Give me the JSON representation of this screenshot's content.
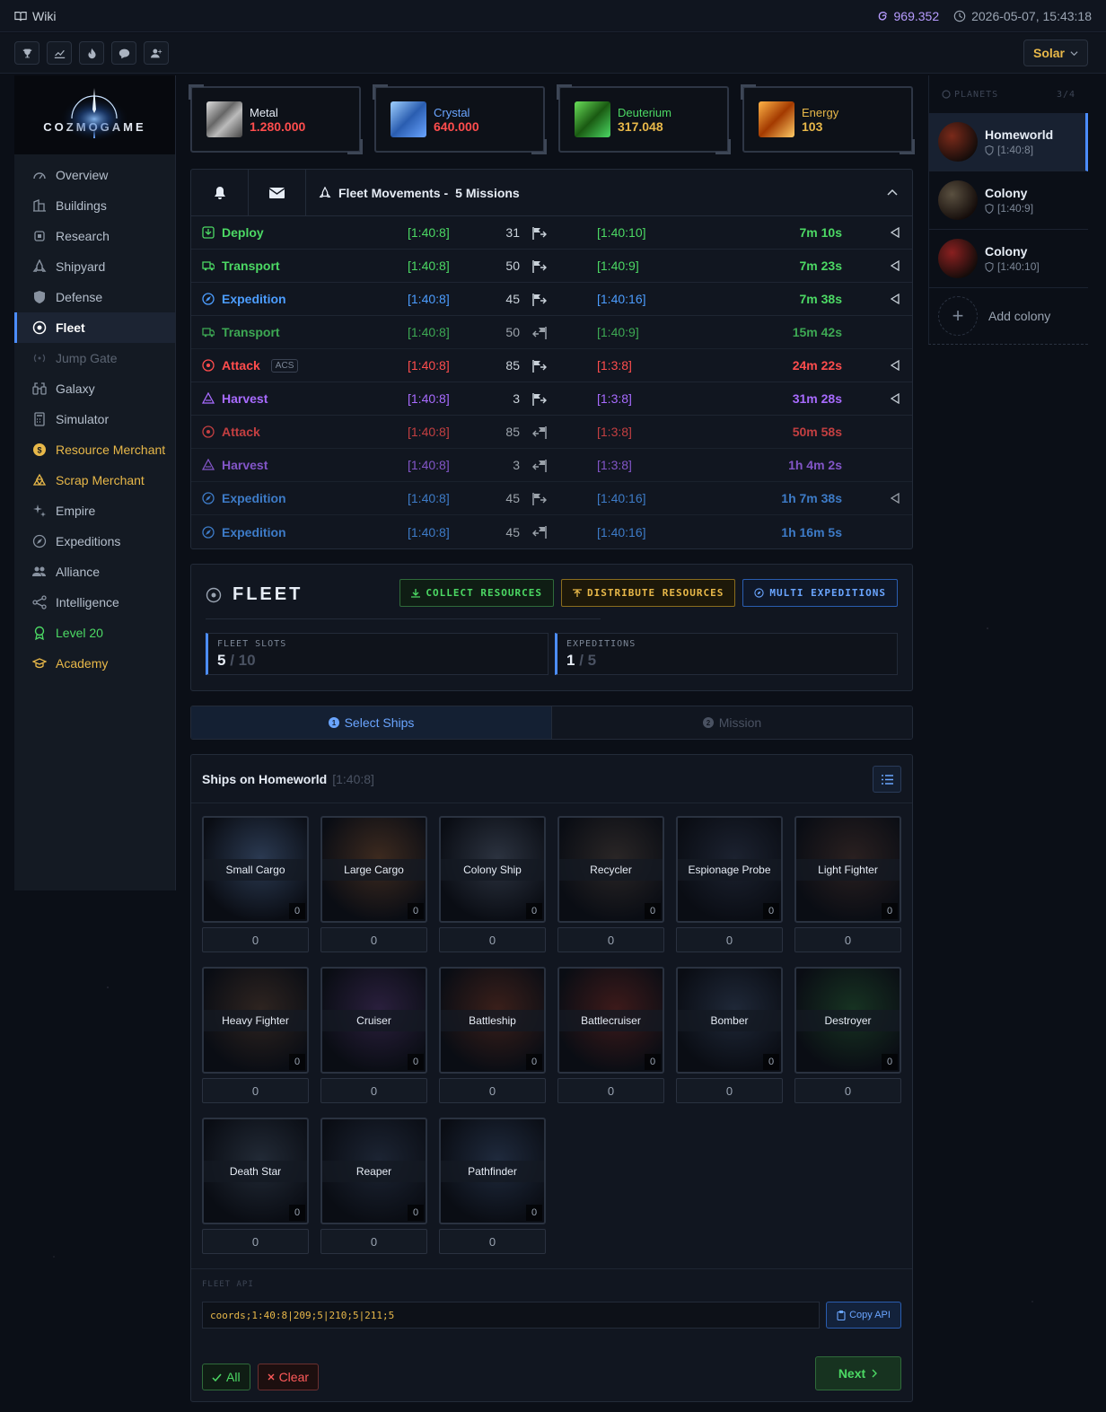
{
  "topbar": {
    "wiki": "Wiki",
    "dark_matter": "969.352",
    "datetime": "2026-05-07, 15:43:18"
  },
  "toolbar": {
    "icons": [
      "trophy-icon",
      "chart-icon",
      "fire-icon",
      "chat-icon",
      "user-add-icon"
    ],
    "universe": "Solar"
  },
  "logo": "COZMOGAME",
  "nav": [
    {
      "label": "Overview",
      "icon": "gauge-icon",
      "state": "normal"
    },
    {
      "label": "Buildings",
      "icon": "building-icon",
      "state": "normal"
    },
    {
      "label": "Research",
      "icon": "chip-icon",
      "state": "normal"
    },
    {
      "label": "Shipyard",
      "icon": "rocket-icon",
      "state": "normal"
    },
    {
      "label": "Defense",
      "icon": "shield-icon",
      "state": "normal"
    },
    {
      "label": "Fleet",
      "icon": "target-icon",
      "state": "active"
    },
    {
      "label": "Jump Gate",
      "icon": "signal-icon",
      "state": "dim"
    },
    {
      "label": "Galaxy",
      "icon": "binoculars-icon",
      "state": "normal"
    },
    {
      "label": "Simulator",
      "icon": "calculator-icon",
      "state": "normal"
    },
    {
      "label": "Resource Merchant",
      "icon": "coin-icon",
      "state": "gold"
    },
    {
      "label": "Scrap Merchant",
      "icon": "recycle-icon",
      "state": "gold"
    },
    {
      "label": "Empire",
      "icon": "sparkle-icon",
      "state": "normal"
    },
    {
      "label": "Expeditions",
      "icon": "compass-icon",
      "state": "normal"
    },
    {
      "label": "Alliance",
      "icon": "users-icon",
      "state": "normal"
    },
    {
      "label": "Intelligence",
      "icon": "share-icon",
      "state": "normal"
    },
    {
      "label": "Level 20",
      "icon": "award-icon",
      "state": "green"
    },
    {
      "label": "Academy",
      "icon": "graduation-icon",
      "state": "gold"
    }
  ],
  "resources": [
    {
      "name": "Metal",
      "value": "1.280.000",
      "color": "#ff4d4d",
      "name_color": "#e6ecf5"
    },
    {
      "name": "Crystal",
      "value": "640.000",
      "color": "#ff4d4d",
      "name_color": "#6aa5ff"
    },
    {
      "name": "Deuterium",
      "value": "317.048",
      "color": "#e8b849",
      "name_color": "#4cd964"
    },
    {
      "name": "Energy",
      "value": "103",
      "color": "#e8b849",
      "name_color": "#e8b849"
    }
  ],
  "fleet_movements": {
    "title": "Fleet Movements -",
    "count": "5 Missions"
  },
  "movements": [
    {
      "mission": "Deploy",
      "from": "[1:40:8]",
      "ships": "31",
      "to": "[1:40:10]",
      "time": "7m 10s",
      "color": "g",
      "dir": "out",
      "back": true,
      "dim": false,
      "time_color": "g",
      "acs": ""
    },
    {
      "mission": "Transport",
      "from": "[1:40:8]",
      "ships": "50",
      "to": "[1:40:9]",
      "time": "7m 23s",
      "color": "g",
      "dir": "out",
      "back": true,
      "dim": false,
      "time_color": "g",
      "acs": ""
    },
    {
      "mission": "Expedition",
      "from": "[1:40:8]",
      "ships": "45",
      "to": "[1:40:16]",
      "time": "7m 38s",
      "color": "b",
      "dir": "out",
      "back": true,
      "dim": false,
      "time_color": "g",
      "acs": ""
    },
    {
      "mission": "Transport",
      "from": "[1:40:8]",
      "ships": "50",
      "to": "[1:40:9]",
      "time": "15m 42s",
      "color": "g",
      "dir": "ret",
      "back": false,
      "dim": true,
      "time_color": "g",
      "acs": ""
    },
    {
      "mission": "Attack",
      "from": "[1:40:8]",
      "ships": "85",
      "to": "[1:3:8]",
      "time": "24m 22s",
      "color": "r",
      "dir": "out",
      "back": true,
      "dim": false,
      "time_color": "r",
      "acs": "ACS"
    },
    {
      "mission": "Harvest",
      "from": "[1:40:8]",
      "ships": "3",
      "to": "[1:3:8]",
      "time": "31m 28s",
      "color": "p",
      "dir": "out",
      "back": true,
      "dim": false,
      "time_color": "p",
      "acs": ""
    },
    {
      "mission": "Attack",
      "from": "[1:40:8]",
      "ships": "85",
      "to": "[1:3:8]",
      "time": "50m 58s",
      "color": "r",
      "dir": "ret",
      "back": false,
      "dim": true,
      "time_color": "r",
      "acs": ""
    },
    {
      "mission": "Harvest",
      "from": "[1:40:8]",
      "ships": "3",
      "to": "[1:3:8]",
      "time": "1h 4m 2s",
      "color": "p",
      "dir": "ret",
      "back": false,
      "dim": true,
      "time_color": "p",
      "acs": ""
    },
    {
      "mission": "Expedition",
      "from": "[1:40:8]",
      "ships": "45",
      "to": "[1:40:16]",
      "time": "1h 7m 38s",
      "color": "b",
      "dir": "out",
      "back": true,
      "dim": true,
      "time_color": "b",
      "acs": ""
    },
    {
      "mission": "Expedition",
      "from": "[1:40:8]",
      "ships": "45",
      "to": "[1:40:16]",
      "time": "1h 16m 5s",
      "color": "b",
      "dir": "ret",
      "back": false,
      "dim": true,
      "time_color": "b",
      "acs": ""
    }
  ],
  "fleet": {
    "title": "FLEET",
    "collect": "COLLECT RESOURCES",
    "distribute": "DISTRIBUTE RESOURCES",
    "multi": "MULTI EXPEDITIONS",
    "slots_label": "FLEET SLOTS",
    "slots_used": "5",
    "slots_max": "/ 10",
    "exp_label": "EXPEDITIONS",
    "exp_used": "1",
    "exp_max": "/ 5"
  },
  "steps": {
    "step1": "Select Ships",
    "step2": "Mission"
  },
  "ships_panel": {
    "title": "Ships on Homeworld",
    "coord": "[1:40:8]"
  },
  "ships": [
    {
      "name": "Small Cargo",
      "count": "0",
      "input": "0",
      "bg": "#2b3a52"
    },
    {
      "name": "Large Cargo",
      "count": "0",
      "input": "0",
      "bg": "#3d2a1f"
    },
    {
      "name": "Colony Ship",
      "count": "0",
      "input": "0",
      "bg": "#2c3340"
    },
    {
      "name": "Recycler",
      "count": "0",
      "input": "0",
      "bg": "#2a2626"
    },
    {
      "name": "Espionage Probe",
      "count": "0",
      "input": "0",
      "bg": "#1c2230"
    },
    {
      "name": "Light Fighter",
      "count": "0",
      "input": "0",
      "bg": "#2a2020"
    },
    {
      "name": "Heavy Fighter",
      "count": "0",
      "input": "0",
      "bg": "#2e2420"
    },
    {
      "name": "Cruiser",
      "count": "0",
      "input": "0",
      "bg": "#2a1f3d"
    },
    {
      "name": "Battleship",
      "count": "0",
      "input": "0",
      "bg": "#3a1f1a"
    },
    {
      "name": "Battlecruiser",
      "count": "0",
      "input": "0",
      "bg": "#3d1a1a"
    },
    {
      "name": "Bomber",
      "count": "0",
      "input": "0",
      "bg": "#1f2838"
    },
    {
      "name": "Destroyer",
      "count": "0",
      "input": "0",
      "bg": "#173322"
    },
    {
      "name": "Death Star",
      "count": "0",
      "input": "0",
      "bg": "#222a36"
    },
    {
      "name": "Reaper",
      "count": "0",
      "input": "0",
      "bg": "#1c2433"
    },
    {
      "name": "Pathfinder",
      "count": "0",
      "input": "0",
      "bg": "#1f2a3d"
    }
  ],
  "api": {
    "label": "FLEET API",
    "value": "coords;1:40:8|209;5|210;5|211;5",
    "copy": "Copy API"
  },
  "actions": {
    "all": "All",
    "clear": "Clear",
    "next": "Next"
  },
  "planets": {
    "label": "PLANETS",
    "count": "3/4",
    "items": [
      {
        "name": "Homeworld",
        "coord": "[1:40:8]",
        "active": true,
        "color": "#7a2a1a"
      },
      {
        "name": "Colony",
        "coord": "[1:40:9]",
        "active": false,
        "color": "#5a5040"
      },
      {
        "name": "Colony",
        "coord": "[1:40:10]",
        "active": false,
        "color": "#8a2020"
      }
    ],
    "add": "Add colony"
  }
}
